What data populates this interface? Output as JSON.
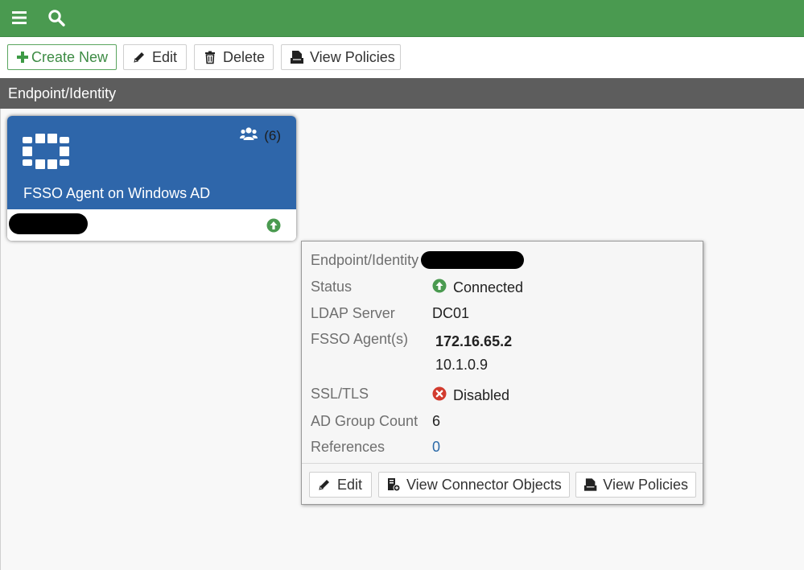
{
  "topbar": {
    "menu_icon": "hamburger-menu-icon",
    "search_icon": "search-icon",
    "color": "#4a9a50"
  },
  "toolbar": {
    "create_new_label": "Create New",
    "edit_label": "Edit",
    "delete_label": "Delete",
    "view_policies_label": "View Policies"
  },
  "section": {
    "title": "Endpoint/Identity"
  },
  "card": {
    "title": "FSSO Agent on Windows AD",
    "group_count": "(6)",
    "logo_icon": "fortinet-grid-icon",
    "status_icon": "status-up-icon",
    "color": "#2e66aa"
  },
  "tooltip": {
    "header_label": "Endpoint/Identity",
    "rows": {
      "status": {
        "label": "Status",
        "value": "Connected",
        "color": "#4a9a50"
      },
      "ldap": {
        "label": "LDAP Server",
        "value": "DC01"
      },
      "agents": {
        "label": "FSSO Agent(s)",
        "primary": "172.16.65.2",
        "secondary": "10.1.0.9"
      },
      "ssl": {
        "label": "SSL/TLS",
        "value": "Disabled",
        "color": "#d23b2e"
      },
      "ad_group_count": {
        "label": "AD Group Count",
        "value": "6"
      },
      "references": {
        "label": "References",
        "value": "0",
        "color": "#2b6aa8"
      }
    },
    "actions": {
      "edit_label": "Edit",
      "view_connector_objects_label": "View Connector Objects",
      "view_policies_label": "View Policies"
    }
  }
}
